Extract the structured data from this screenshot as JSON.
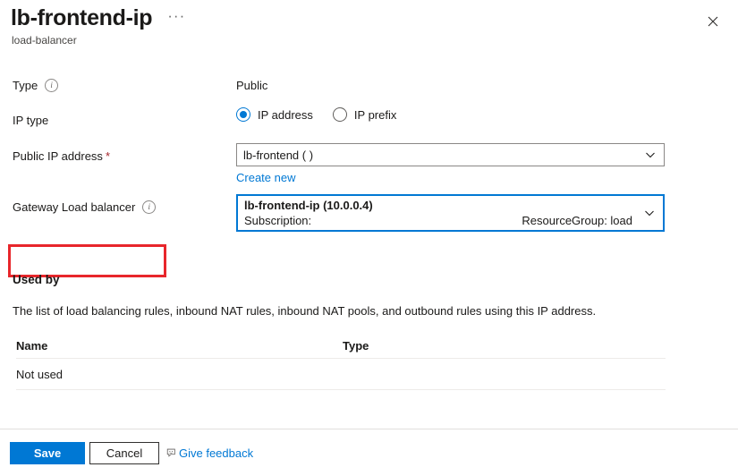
{
  "header": {
    "title": "lb-frontend-ip",
    "subtitle": "load-balancer",
    "more_label": "···",
    "close_label": "✕"
  },
  "form": {
    "type": {
      "label": "Type",
      "value": "Public"
    },
    "ip_type": {
      "label": "IP type",
      "options": [
        {
          "label": "IP address",
          "selected": true
        },
        {
          "label": "IP prefix",
          "selected": false
        }
      ]
    },
    "public_ip_address": {
      "label": "Public IP address",
      "required_mark": "*",
      "value": "lb-frontend (                    )",
      "create_new_label": "Create new"
    },
    "gateway_load_balancer": {
      "label": "Gateway Load balancer",
      "value_line1": "lb-frontend-ip (10.0.0.4)",
      "value_line2_left": "Subscription:",
      "value_line2_right": "ResourceGroup: load"
    }
  },
  "used_by": {
    "heading": "Used by",
    "description": "The list of load balancing rules, inbound NAT rules, inbound NAT pools, and outbound rules using this IP address.",
    "columns": [
      "Name",
      "Type"
    ],
    "rows": [
      {
        "name": "Not used",
        "type": ""
      }
    ]
  },
  "footer": {
    "save_label": "Save",
    "cancel_label": "Cancel",
    "feedback_label": "Give feedback"
  },
  "colors": {
    "accent": "#0078d4",
    "highlight": "#e8262b",
    "required": "#a4262c"
  }
}
